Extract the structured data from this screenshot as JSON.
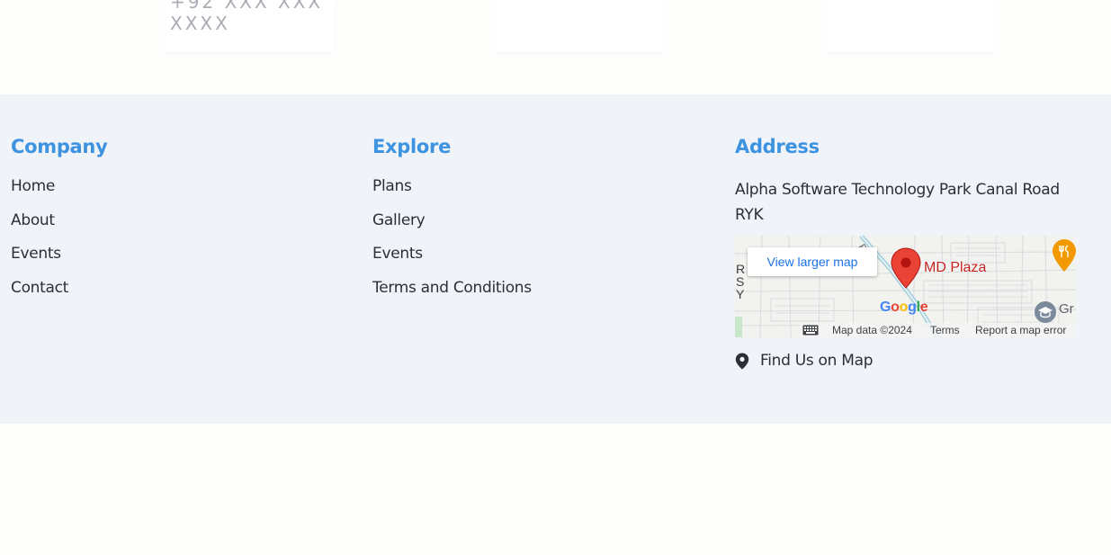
{
  "top_cards": {
    "partial_text": "+92 XXX XXX XXXX"
  },
  "footer": {
    "company": {
      "title": "Company",
      "links": [
        "Home",
        "About",
        "Events",
        "Contact"
      ]
    },
    "explore": {
      "title": "Explore",
      "links": [
        "Plans",
        "Gallery",
        "Events",
        "Terms and Conditions"
      ]
    },
    "address": {
      "title": "Address",
      "text": "Alpha Software Technology Park Canal Road RYK",
      "map": {
        "view_larger": "View larger map",
        "place_label": "MD Plaza",
        "brand": "Google",
        "map_data": "Map data ©2024",
        "terms": "Terms",
        "report": "Report a map error",
        "edge_label_right": "Gr",
        "edge_label_left": "RS Y"
      },
      "find_link": "Find Us on Map"
    }
  },
  "colors": {
    "heading": "#3d93e0",
    "footer_bg": "#f0f3f8",
    "page_bg": "#fdfdfb",
    "pin": "#ea4335"
  },
  "icons": {
    "find_link": "map-marker-icon",
    "map_pin": "map-pin-icon",
    "restaurant": "restaurant-icon",
    "school": "school-icon",
    "keyboard": "keyboard-icon"
  }
}
